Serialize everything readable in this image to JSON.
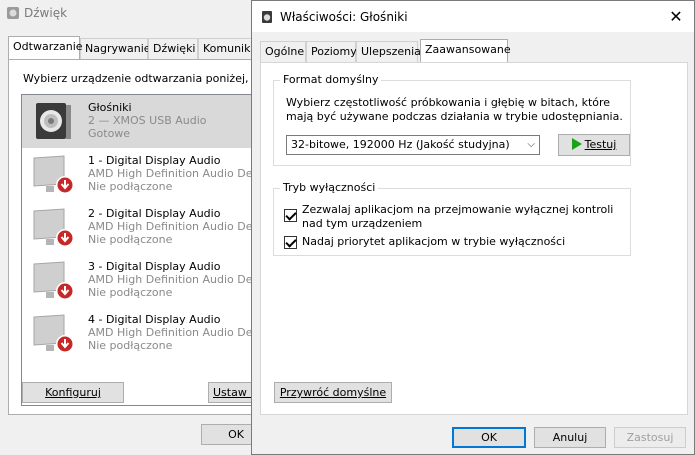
{
  "bg_window": {
    "title": "Dźwięk",
    "tabs": [
      "Odtwarzanie",
      "Nagrywanie",
      "Dźwięki",
      "Komunikac"
    ],
    "active_tab": 0,
    "hint": "Wybierz urządzenie odtwarzania poniżej, aby",
    "devices": [
      {
        "name": "Głośniki",
        "sub": "2 — XMOS USB Audio",
        "status": "Gotowe",
        "icon": "speaker-icon",
        "selected": true
      },
      {
        "name": "1 - Digital Display Audio",
        "sub": "AMD High Definition Audio Dev",
        "status": "Nie podłączone",
        "icon": "monitor-disconnected-icon"
      },
      {
        "name": "2 - Digital Display Audio",
        "sub": "AMD High Definition Audio Dev",
        "status": "Nie podłączone",
        "icon": "monitor-disconnected-icon"
      },
      {
        "name": "3 - Digital Display Audio",
        "sub": "AMD High Definition Audio Dev",
        "status": "Nie podłączone",
        "icon": "monitor-disconnected-icon"
      },
      {
        "name": "4 - Digital Display Audio",
        "sub": "AMD High Definition Audio Dev",
        "status": "Nie podłączone",
        "icon": "monitor-disconnected-icon"
      }
    ],
    "configure_button": "Konfiguruj",
    "set_default_button": "Ustaw d",
    "ok_button": "OK"
  },
  "dialog": {
    "title": "Właściwości: Głośniki",
    "tabs": [
      "Ogólne",
      "Poziomy",
      "Ulepszenia",
      "Zaawansowane"
    ],
    "active_tab": 3,
    "format_group": {
      "label": "Format domyślny",
      "description": "Wybierz częstotliwość próbkowania i głębię w bitach, które mają być używane podczas działania w trybie udostępniania.",
      "selected_format": "32-bitowe, 192000 Hz (Jakość studyjna)",
      "test_button": "Testuj"
    },
    "exclusive_group": {
      "label": "Tryb wyłączności",
      "option1": "Zezwalaj aplikacjom na przejmowanie wyłącznej kontroli nad tym urządzeniem",
      "option1_checked": true,
      "option2": "Nadaj priorytet aplikacjom w trybie wyłączności",
      "option2_checked": true
    },
    "restore_button": "Przywróć domyślne",
    "ok_button": "OK",
    "cancel_button": "Anuluj",
    "apply_button": "Zastosuj"
  }
}
